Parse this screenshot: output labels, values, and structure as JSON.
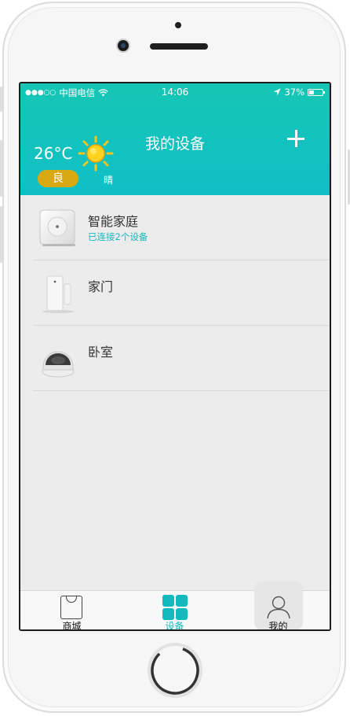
{
  "status_bar": {
    "carrier": "中国电信",
    "time": "14:06",
    "battery": "37%",
    "battery_level": 0.37
  },
  "header": {
    "title": "我的设备",
    "add_icon": "plus-icon",
    "temperature": "26°C",
    "air_quality": "良",
    "weather": "晴",
    "weather_icon": "sun-icon",
    "accent_color": "#14c3bc"
  },
  "devices": [
    {
      "name": "智能家庭",
      "subtitle": "已连接2个设备",
      "icon": "gateway-device-icon"
    },
    {
      "name": "家门",
      "subtitle": "",
      "icon": "door-sensor-icon"
    },
    {
      "name": "卧室",
      "subtitle": "",
      "icon": "camera-device-icon"
    }
  ],
  "tabbar": {
    "tabs": [
      {
        "label": "商城",
        "icon": "shopping-bag-icon"
      },
      {
        "label": "设备",
        "icon": "grid-icon",
        "active": true
      },
      {
        "label": "我的",
        "icon": "user-icon"
      }
    ]
  }
}
